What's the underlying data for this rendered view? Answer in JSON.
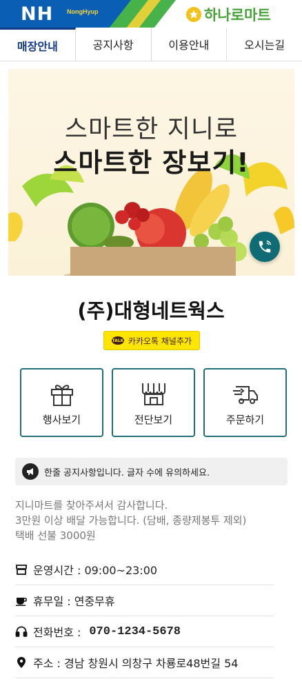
{
  "header": {
    "brand_main": "NH",
    "brand_sub": "NongHyup",
    "mart_logo": "하나로마트",
    "colors": {
      "blue": "#0a5fb4",
      "green": "#47b14a",
      "yellow": "#f3d43a"
    }
  },
  "tabs": [
    {
      "label": "매장안내",
      "active": true
    },
    {
      "label": "공지사항",
      "active": false
    },
    {
      "label": "이용안내",
      "active": false
    },
    {
      "label": "오시는길",
      "active": false
    }
  ],
  "banner": {
    "line1": "스마트한 지니로",
    "line2": "스마트한 장보기!",
    "call_icon": "phone-icon"
  },
  "store": {
    "name": "(주)대형네트웍스",
    "kakao_badge": "TALK",
    "kakao_label": "카카오톡 채널추가"
  },
  "actions": [
    {
      "label": "행사보기",
      "icon": "gift-icon"
    },
    {
      "label": "전단보기",
      "icon": "flyer-icon"
    },
    {
      "label": "주문하기",
      "icon": "delivery-truck-icon"
    }
  ],
  "notice": {
    "text": "한줄 공지사항입니다. 글자 수에 유의하세요.",
    "icon": "megaphone-icon"
  },
  "intro": {
    "lines": [
      "지니마트를 찾아주셔서 감사합니다.",
      "3만원 이상 배달 가능합니다. (담배, 종량제봉투 제외)",
      "택배 선불 3000원"
    ]
  },
  "info": {
    "hours": "운영시간 : 09:00~23:00",
    "holiday": "휴무일 : 연중무휴",
    "phone_label": "전화번호 :",
    "phone_number": "070-1234-5678",
    "address": "주소 : 경남 창원시 의창구 차룡로48번길 54"
  },
  "accent_color": "#1f6e78"
}
